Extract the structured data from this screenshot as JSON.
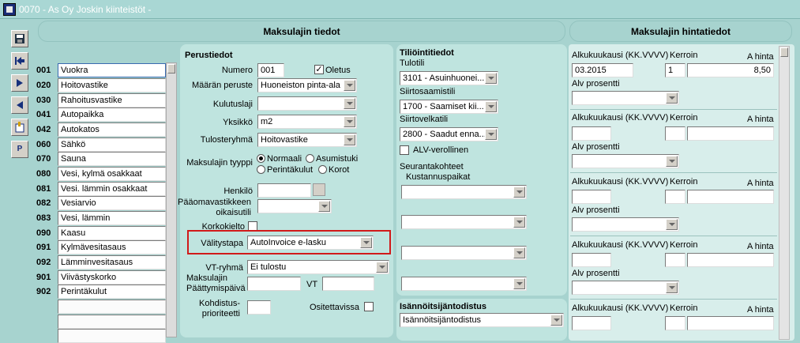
{
  "window": {
    "title": "0070 - As Oy Joskin kiinteistöt -"
  },
  "headers": {
    "main": "Maksulajin tiedot",
    "price": "Maksulajin hintatiedot"
  },
  "toolbar": {
    "p_label": "P"
  },
  "list": {
    "rows": [
      {
        "code": "001",
        "name": "Vuokra"
      },
      {
        "code": "020",
        "name": "Hoitovastike"
      },
      {
        "code": "030",
        "name": "Rahoitusvastike"
      },
      {
        "code": "041",
        "name": "Autopaikka"
      },
      {
        "code": "042",
        "name": "Autokatos"
      },
      {
        "code": "060",
        "name": "Sähkö"
      },
      {
        "code": "070",
        "name": "Sauna"
      },
      {
        "code": "080",
        "name": "Vesi, kylmä osakkaat"
      },
      {
        "code": "081",
        "name": "Vesi. lämmin osakkaat"
      },
      {
        "code": "082",
        "name": "Vesiarvio"
      },
      {
        "code": "083",
        "name": "Vesi, lämmin"
      },
      {
        "code": "090",
        "name": "Kaasu"
      },
      {
        "code": "091",
        "name": "Kylmävesitasaus"
      },
      {
        "code": "092",
        "name": "Lämminvesitasaus"
      },
      {
        "code": "901",
        "name": "Viivästyskorko"
      },
      {
        "code": "902",
        "name": "Perintäkulut"
      }
    ]
  },
  "basic": {
    "title": "Perustiedot",
    "numero_label": "Numero",
    "numero_value": "001",
    "oletus_label": "Oletus",
    "maaran_peruste_label": "Määrän peruste",
    "maaran_peruste_value": "Huoneiston pinta-ala",
    "kulutuslaji_label": "Kulutuslaji",
    "yksikko_label": "Yksikkö",
    "yksikko_value": "m2",
    "tulosteryhma_label": "Tulosteryhmä",
    "tulosteryhma_value": "Hoitovastike",
    "tyyppi_label": "Maksulajin tyyppi",
    "radio_normaali": "Normaali",
    "radio_asumistuki": "Asumistuki",
    "radio_perintakulut": "Perintäkulut",
    "radio_korot": "Korot",
    "henkilo_label": "Henkilö",
    "paaoma_label_1": "Pääomavastikkeen",
    "paaoma_label_2": "oikaisutili",
    "korkokielto_label": "Korkokielto",
    "valitystapa_label": "Välitystapa",
    "valitystapa_value": "AutoInvoice e-lasku",
    "vt_ryhma_label": "VT-ryhmä",
    "vt_ryhma_value": "Ei tulostu",
    "paattymis_label_1": "Maksulajin",
    "paattymis_label_2": "Päättymispäivä",
    "vt_label": "VT",
    "kohdistus_label_1": "Kohdistus-",
    "kohdistus_label_2": "prioriteetti",
    "ositettavissa_label": "Ositettavissa"
  },
  "account": {
    "title": "Tiliöintitiedot",
    "tulotili_label": "Tulotili",
    "tulotili_value": "3101 - Asuinhuonei...",
    "siirtosaamistili_label": "Siirtosaamistili",
    "siirtosaamistili_value": "1700 - Saamiset kii...",
    "siirtovelkatili_label": "Siirtovelkatili",
    "siirtovelkatili_value": "2800 - Saadut enna...",
    "alv_label": "ALV-verollinen",
    "seuranta_label": "Seurantakohteet",
    "kustannus_label": "Kustannuspaikat"
  },
  "cert": {
    "title": "Isännöitsijäntodistus",
    "value": "Isännöitsijäntodistus"
  },
  "price": {
    "alku_label": "Alkukuukausi (KK.VVVV)",
    "kerroin_label": "Kerroin",
    "ahinta_label": "A hinta",
    "alv_label": "Alv prosentti",
    "rows": [
      {
        "alku": "03.2015",
        "kerroin": "1",
        "ahinta": "8,50"
      },
      {
        "alku": "",
        "kerroin": "",
        "ahinta": ""
      },
      {
        "alku": "",
        "kerroin": "",
        "ahinta": ""
      },
      {
        "alku": "",
        "kerroin": "",
        "ahinta": ""
      },
      {
        "alku": "",
        "kerroin": "",
        "ahinta": ""
      }
    ]
  }
}
